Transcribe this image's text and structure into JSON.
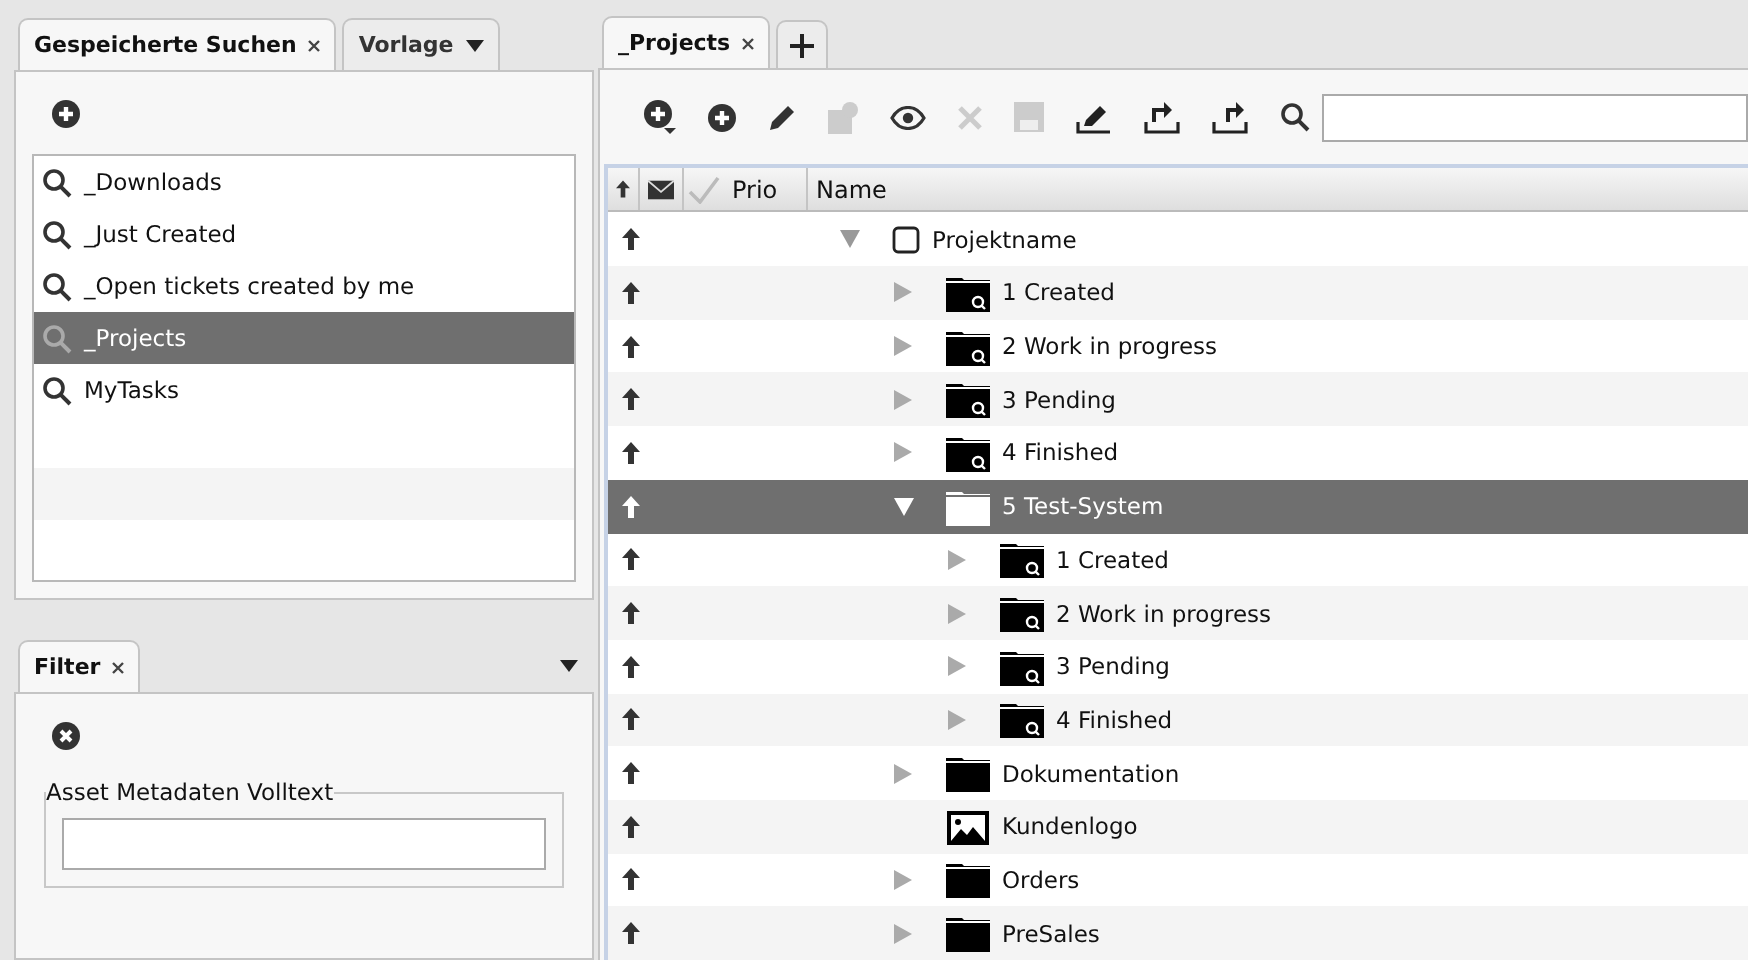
{
  "left_tabs": [
    {
      "label": "Gespeicherte Suchen",
      "selected": true,
      "kind": "closable"
    },
    {
      "label": "Vorlage",
      "selected": false,
      "kind": "dropdown"
    }
  ],
  "saved_searches": [
    {
      "label": "_Downloads",
      "selected": false
    },
    {
      "label": "_Just Created",
      "selected": false
    },
    {
      "label": "_Open tickets created by me",
      "selected": false
    },
    {
      "label": "_Projects",
      "selected": true
    },
    {
      "label": "MyTasks",
      "selected": false
    }
  ],
  "filter": {
    "tab": "Filter",
    "legend": "Asset Metadaten Volltext"
  },
  "main_tabs": [
    {
      "label": "_Projects",
      "selected": true
    }
  ],
  "columns": [
    "Prio",
    "Name"
  ],
  "tree": [
    {
      "label": "Projektname",
      "kind": "root",
      "expanded": true,
      "selected": false,
      "children": [
        {
          "label": "1 Created",
          "kind": "smart-folder",
          "expanded": false,
          "selected": false
        },
        {
          "label": "2 Work in progress",
          "kind": "smart-folder",
          "expanded": false,
          "selected": false
        },
        {
          "label": "3 Pending",
          "kind": "smart-folder",
          "expanded": false,
          "selected": false
        },
        {
          "label": "4 Finished",
          "kind": "smart-folder",
          "expanded": false,
          "selected": false
        },
        {
          "label": "5 Test-System",
          "kind": "folder",
          "expanded": true,
          "selected": true,
          "children": [
            {
              "label": "1 Created",
              "kind": "smart-folder",
              "expanded": false,
              "selected": false
            },
            {
              "label": "2 Work in progress",
              "kind": "smart-folder",
              "expanded": false,
              "selected": false
            },
            {
              "label": "3 Pending",
              "kind": "smart-folder",
              "expanded": false,
              "selected": false
            },
            {
              "label": "4 Finished",
              "kind": "smart-folder",
              "expanded": false,
              "selected": false
            }
          ]
        },
        {
          "label": "Dokumentation",
          "kind": "folder",
          "expanded": false,
          "selected": false
        },
        {
          "label": "Kundenlogo",
          "kind": "image",
          "selected": false
        },
        {
          "label": "Orders",
          "kind": "folder",
          "expanded": false,
          "selected": false
        },
        {
          "label": "PreSales",
          "kind": "folder",
          "expanded": false,
          "selected": false
        }
      ]
    }
  ]
}
